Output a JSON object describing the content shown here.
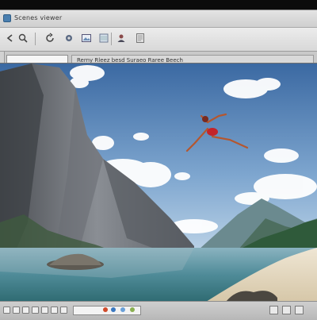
{
  "window": {
    "title": "Scenes viewer"
  },
  "toolbar": {
    "buttons": [
      {
        "name": "back-button",
        "icon": "arrow-left-icon"
      },
      {
        "name": "search-button",
        "icon": "magnifier-icon"
      },
      {
        "name": "refresh-button",
        "icon": "refresh-icon"
      },
      {
        "name": "settings-button",
        "icon": "gear-icon"
      },
      {
        "name": "image-button",
        "icon": "image-icon"
      },
      {
        "name": "layers-button",
        "icon": "layers-icon"
      },
      {
        "name": "user-button",
        "icon": "user-icon"
      },
      {
        "name": "document-button",
        "icon": "document-icon"
      }
    ]
  },
  "statusbar": {
    "text": "Rerny Rleez besd Suraeo Raree Beech"
  },
  "scene": {
    "description_icon": "landscape-photo",
    "colors": {
      "sky_top": "#3f6fa6",
      "sky_bottom": "#a9c8e4",
      "water": "#5a8f9a",
      "sand": "#e8dcc6",
      "figure": "#c3242a"
    }
  },
  "bottombar": {
    "zoom_label": ""
  }
}
